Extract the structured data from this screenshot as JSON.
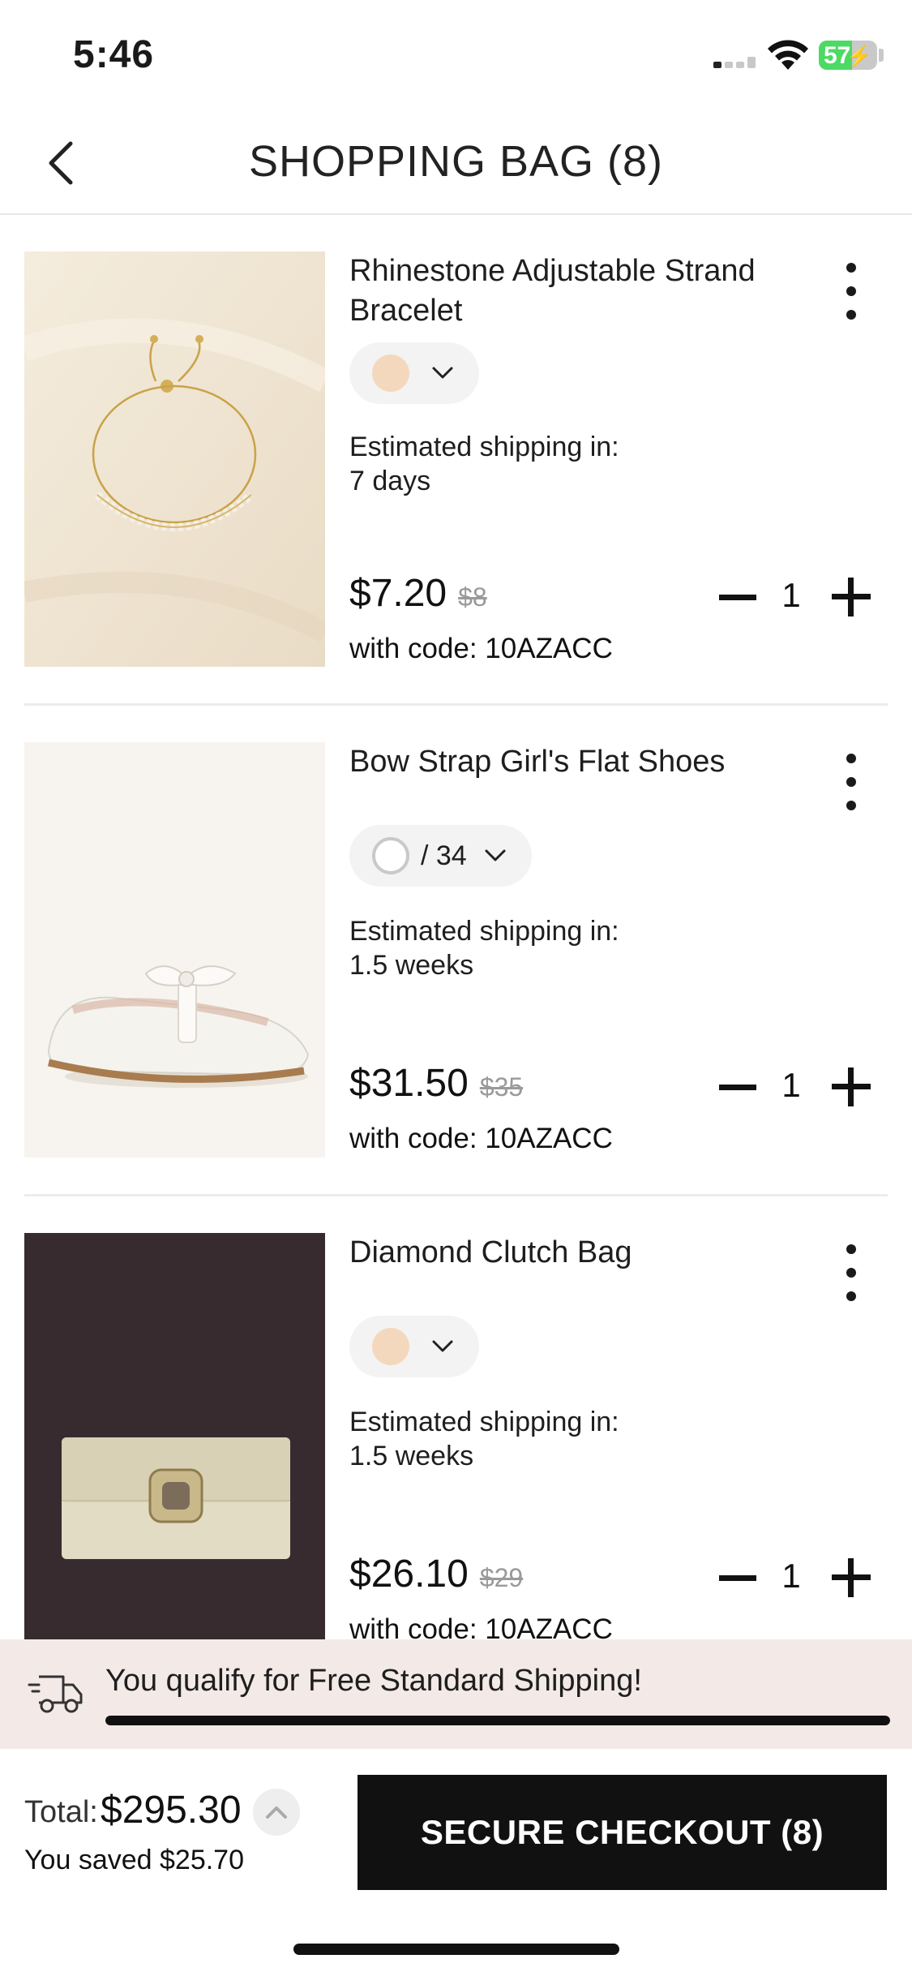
{
  "status_bar": {
    "time": "5:46",
    "battery_percent": "57",
    "battery_level": 0.57,
    "signal_bars_active": 1
  },
  "header": {
    "title": "SHOPPING BAG (8)",
    "back_icon": "chevron-left-icon"
  },
  "items": [
    {
      "name": "Rhinestone Adjustable Strand Bracelet",
      "variant_color": "#f4d8bd",
      "variant_size": "",
      "shipping_label": "Estimated shipping in:",
      "shipping_time": "7 days",
      "price": "$7.20",
      "original_price": "$8",
      "code_text": "with code: 10AZACC",
      "quantity": "1",
      "image": "gold-bracelet-photo"
    },
    {
      "name": "Bow Strap Girl's Flat Shoes",
      "variant_color": "#ffffff",
      "variant_size": "/ 34",
      "shipping_label": "Estimated shipping in:",
      "shipping_time": "1.5 weeks",
      "price": "$31.50",
      "original_price": "$35",
      "code_text": "with code: 10AZACC",
      "quantity": "1",
      "image": "white-flat-shoe-photo"
    },
    {
      "name": "Diamond Clutch Bag",
      "variant_color": "#f4d8bd",
      "variant_size": "",
      "shipping_label": "Estimated shipping in:",
      "shipping_time": "1.5 weeks",
      "price": "$26.10",
      "original_price": "$29",
      "code_text": "with code: 10AZACC",
      "quantity": "1",
      "image": "champagne-clutch-photo"
    }
  ],
  "shipping_banner": {
    "text": "You qualify for Free Standard Shipping!",
    "progress": 1.0,
    "icon": "delivery-truck-icon"
  },
  "footer": {
    "total_label": "Total:",
    "total_value": "$295.30",
    "saved_text": "You saved $25.70",
    "checkout_label": "SECURE CHECKOUT (8)"
  },
  "colors": {
    "accent_dark": "#111111",
    "banner_bg": "#f3e9e7",
    "battery_green": "#4cd964"
  }
}
